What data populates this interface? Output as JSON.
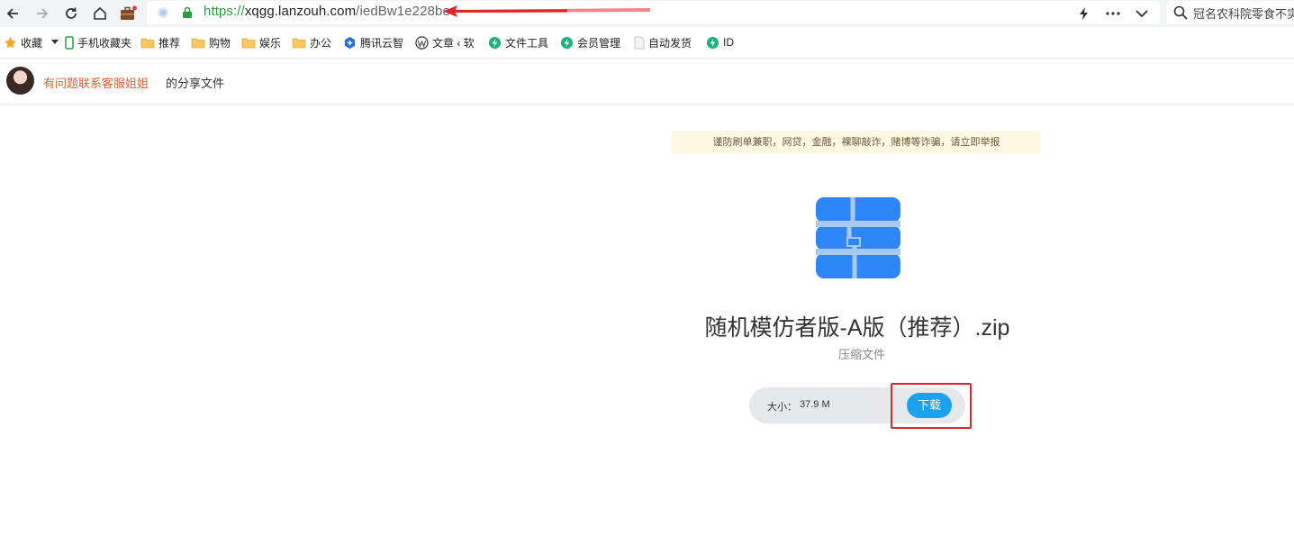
{
  "colors": {
    "accent_blue": "#1aa1f0",
    "file_icon_blue": "#2f86f6",
    "sharer_orange": "#e25d33",
    "annotation_red": "#e0262a",
    "notice_bg": "#fdf8e4",
    "url_green": "#2a9d3c"
  },
  "browser": {
    "nav_icons": [
      "back-arrow-icon",
      "forward-arrow-icon",
      "reload-icon",
      "home-icon",
      "briefcase-icon"
    ],
    "url": {
      "protocol": "https://",
      "host": "xqgg.lanzouh.com",
      "path": "/iedBw1e228be"
    },
    "right_icons": [
      "lightning-icon",
      "more-icon",
      "chevron-down-icon"
    ],
    "search_placeholder": "冠名农科院零食不实"
  },
  "bookmarks": [
    {
      "label": "收藏",
      "icon": "star-icon"
    },
    {
      "label": "手机收藏夹",
      "icon": "phone-icon"
    },
    {
      "label": "推荐",
      "icon": "folder-icon"
    },
    {
      "label": "购物",
      "icon": "folder-icon"
    },
    {
      "label": "娱乐",
      "icon": "folder-icon"
    },
    {
      "label": "办公",
      "icon": "folder-icon"
    },
    {
      "label": "腾讯云智",
      "icon": "tencent-cloud-icon"
    },
    {
      "label": "文章 ‹ 软",
      "icon": "wordpress-icon"
    },
    {
      "label": "文件工具",
      "icon": "bolt-badge-icon"
    },
    {
      "label": "会员管理",
      "icon": "bolt-badge-icon"
    },
    {
      "label": "自动发货",
      "icon": "page-icon"
    },
    {
      "label": "ID",
      "icon": "bolt-badge-icon"
    }
  ],
  "header": {
    "sharer_name": "有问题联系客服姐姐",
    "sharer_suffix": "的分享文件"
  },
  "notice": "谨防刷单兼职，网贷，金融，裸聊敲诈，赌博等诈骗，请立即举报",
  "file": {
    "name": "随机模仿者版-A版（推荐）.zip",
    "type": "压缩文件",
    "size_label": "大小：",
    "size_value": "37.9 M",
    "download_label": "下载"
  }
}
